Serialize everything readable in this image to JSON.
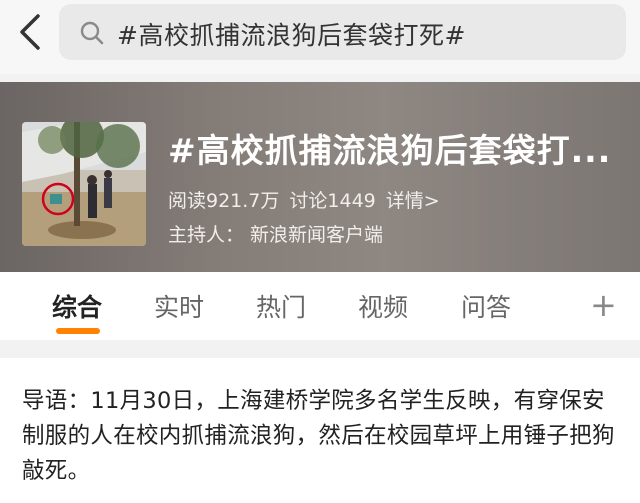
{
  "search": {
    "query": "#高校抓捕流浪狗后套袋打死#"
  },
  "icons": {
    "back": "back-arrow-icon",
    "search": "search-icon",
    "add": "plus-icon"
  },
  "topic": {
    "title": "#高校抓捕流浪狗后套袋打...",
    "reads": "阅读921.7万",
    "discussions": "讨论1449",
    "details_link": "详情>",
    "host_label": "主持人：",
    "host_name": "新浪新闻客户端"
  },
  "tabs": [
    {
      "label": "综合",
      "active": true
    },
    {
      "label": "实时",
      "active": false
    },
    {
      "label": "热门",
      "active": false
    },
    {
      "label": "视频",
      "active": false
    },
    {
      "label": "问答",
      "active": false
    }
  ],
  "add_tab_symbol": "+",
  "intro": {
    "text": "导语：11月30日，上海建桥学院多名学生反映，有穿保安制服的人在校内抓捕流浪狗，然后在校园草坪上用锤子把狗敲死。"
  },
  "colors": {
    "accent": "#ff8200",
    "banner": "#857d78",
    "annotation_circle": "#d0021b"
  }
}
